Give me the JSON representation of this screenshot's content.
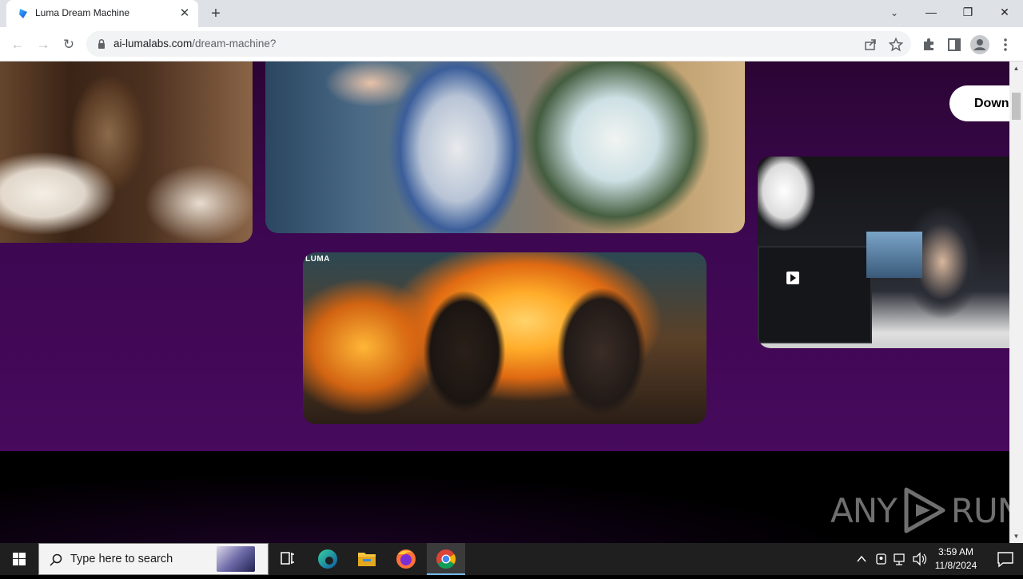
{
  "browser": {
    "tab": {
      "title": "Luma Dream Machine",
      "close_glyph": "✕"
    },
    "new_tab_glyph": "+",
    "url": {
      "host": "ai-lumalabs.com",
      "path": "/dream-machine?"
    },
    "window_controls": {
      "tab_search": "⌄",
      "minimize": "—",
      "restore": "❐",
      "close": "✕"
    },
    "nav": {
      "back": "←",
      "forward": "→",
      "reload": "↻"
    },
    "icons": [
      "share-icon",
      "bookmark-star-icon",
      "extensions-icon",
      "side-panel-icon",
      "profile-icon",
      "menu-icon"
    ]
  },
  "page": {
    "download_button": "Down",
    "bears_card_brand": "LUMA",
    "colors": {
      "purple": "#3f0750",
      "footer": "#000000"
    }
  },
  "watermark": {
    "left": "ANY",
    "right": "RUN"
  },
  "taskbar": {
    "search_placeholder": "Type here to search",
    "apps": [
      "task-view",
      "edge",
      "file-explorer",
      "firefox",
      "chrome"
    ],
    "clock": {
      "time": "3:59 AM",
      "date": "11/8/2024"
    }
  }
}
